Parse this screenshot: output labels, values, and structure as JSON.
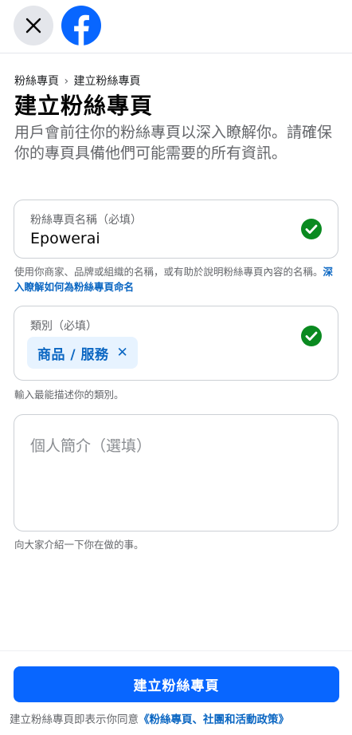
{
  "header": {
    "close_icon": "close-icon",
    "logo_icon": "facebook-logo-icon",
    "brand_color": "#0866ff"
  },
  "breadcrumb": {
    "parent": "粉絲專頁",
    "separator": "›",
    "current": "建立粉絲專頁"
  },
  "title": "建立粉絲專頁",
  "description": "用戶會前往你的粉絲專頁以深入瞭解你。請確保你的專頁具備他們可能需要的所有資訊。",
  "name_field": {
    "label": "粉絲專頁名稱（必填）",
    "value": "Epowerai",
    "status_icon": "check-circle-icon",
    "helper_text": "使用你商家、品牌或組織的名稱，或有助於說明粉絲專頁內容的名稱。",
    "helper_link": "深入瞭解如何為粉絲專頁命名"
  },
  "category_field": {
    "label": "類別（必填）",
    "chip_label": "商品 / 服務",
    "chip_remove_icon": "close-icon",
    "status_icon": "check-circle-icon",
    "helper_text": "輸入最能描述你的類別。"
  },
  "bio_field": {
    "placeholder": "個人簡介（選填）",
    "helper_text": "向大家介紹一下你在做的事。"
  },
  "footer": {
    "create_button_label": "建立粉絲專頁",
    "agree_text": "建立粉絲專頁即表示你同意",
    "policy_link": "《粉絲專頁、社團和活動政策》"
  }
}
